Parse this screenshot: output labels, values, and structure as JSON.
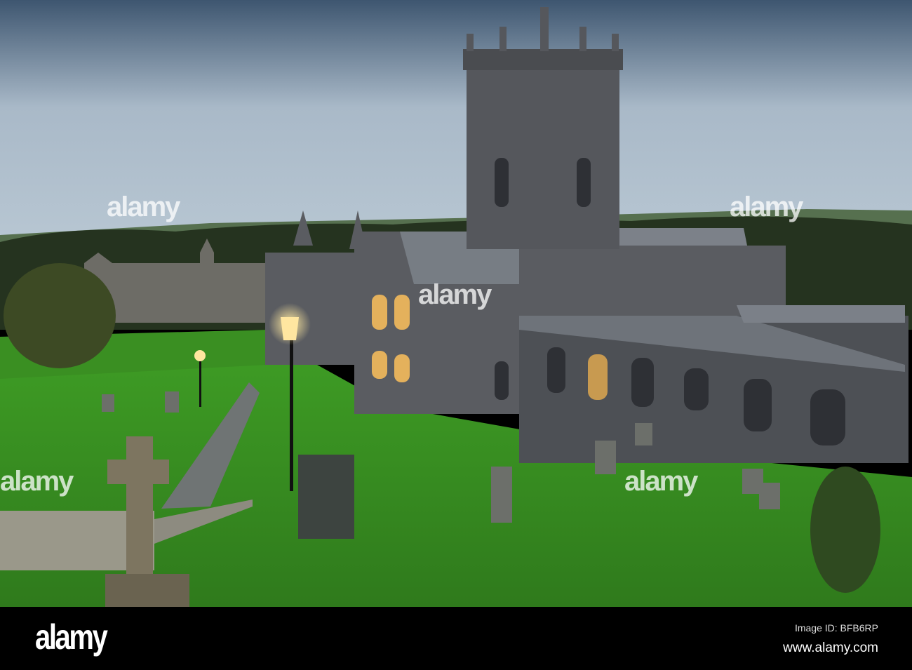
{
  "photo": {
    "subject": "cathedral-at-dusk",
    "sky_color": "#8fa3b6",
    "grass_color": "#3f9a2a",
    "stone_color": "#5b5d62"
  },
  "watermark": {
    "text": "alamy"
  },
  "footer": {
    "logo": "alamy",
    "image_id": "Image ID: BFB6RP",
    "url": "www.alamy.com"
  }
}
